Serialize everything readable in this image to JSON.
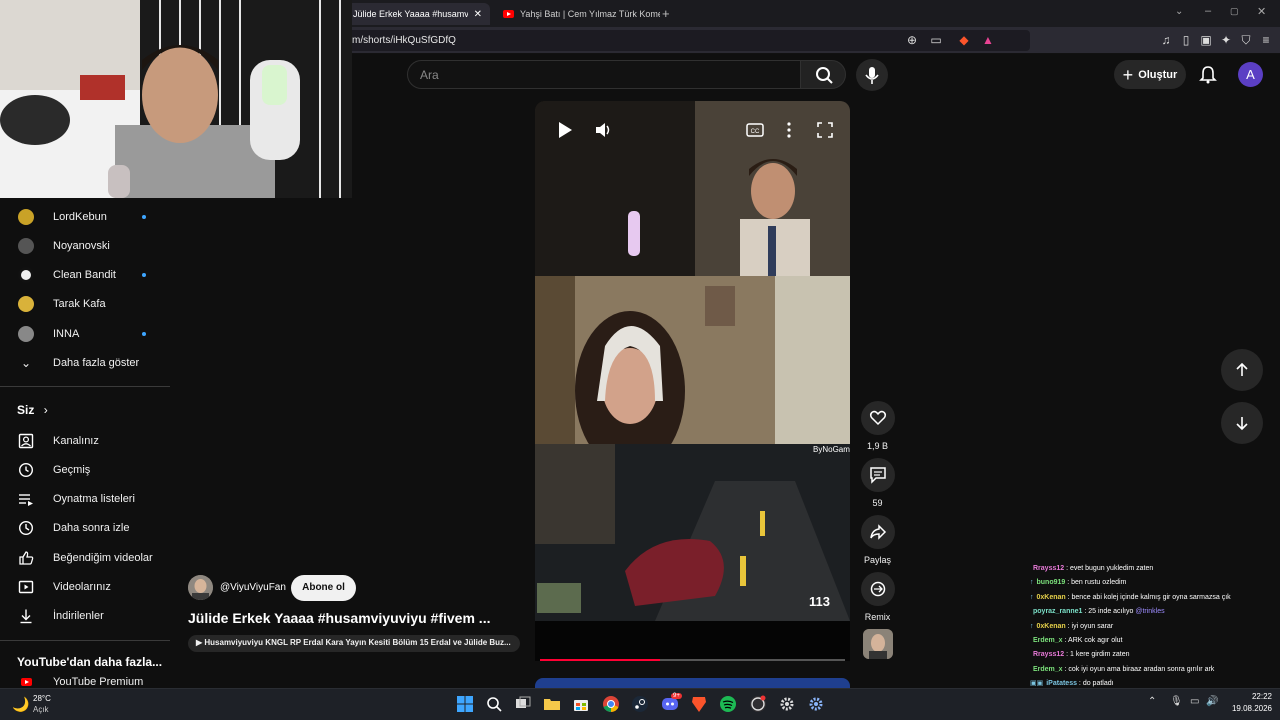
{
  "browser": {
    "tabs": [
      {
        "title": "Jülide Erkek Yaaaa #husamviyuviyu",
        "active": true
      },
      {
        "title": "Yahşi Batı | Cem Yılmaz Türk Komedi",
        "active": false
      }
    ],
    "new_tab": "+",
    "url": "m/shorts/iHkQuSfGDfQ"
  },
  "header": {
    "search_placeholder": "Ara",
    "create_label": "Oluştur",
    "avatar_letter": "A"
  },
  "sidebar": {
    "channels": [
      {
        "name": "LordKebun",
        "live": true,
        "color": "#c9a227"
      },
      {
        "name": "Noyanovski",
        "live": false,
        "color": "#555"
      },
      {
        "name": "Clean Bandit",
        "live": true,
        "color": "#eee"
      },
      {
        "name": "Tarak Kafa",
        "live": false,
        "color": "#d9b23a"
      },
      {
        "name": "INNA",
        "live": true,
        "color": "#888"
      }
    ],
    "show_more": "Daha fazla göster",
    "you_section": "Siz",
    "you_items": [
      {
        "label": "Kanalınız",
        "icon": "channel-icon"
      },
      {
        "label": "Geçmiş",
        "icon": "history-icon"
      },
      {
        "label": "Oynatma listeleri",
        "icon": "playlist-icon"
      },
      {
        "label": "Daha sonra izle",
        "icon": "watch-later-icon"
      },
      {
        "label": "Beğendiğim videolar",
        "icon": "liked-icon"
      },
      {
        "label": "Videolarınız",
        "icon": "your-videos-icon"
      },
      {
        "label": "İndirilenler",
        "icon": "downloads-icon"
      }
    ],
    "more_from": "YouTube'dan daha fazla...",
    "premium": "YouTube Premium"
  },
  "video": {
    "stream_tag": "ByNoGam",
    "speed": "113"
  },
  "actions": {
    "likes": "1,9 B",
    "comments": "59",
    "share": "Paylaş",
    "remix": "Remix"
  },
  "short": {
    "channel": "@ViyuViyuFan",
    "subscribe": "Abone ol",
    "title": "Jülide Erkek Yaaaa #husamviyuviyu #fivem ...",
    "playlist": "Husamviyuviyu KNGL RP Erdal Kara Yayın Kesiti Bölüm 15 Erdal ve Jülide Buz..."
  },
  "chat": [
    {
      "user": "Rrayss12",
      "color": "#e87ad8",
      "msg": " : evet bugun yukledim zaten",
      "badge": ""
    },
    {
      "user": "buno919",
      "color": "#7be07b",
      "msg": " : ben rustu ozledim",
      "badge": "↑"
    },
    {
      "user": "0xKenan",
      "color": "#e6d14a",
      "msg": " : bence abi kolej içinde kalmış gir oyna sarmazsa çık",
      "badge": "↑"
    },
    {
      "user": "poyraz_ranne1",
      "color": "#7be0c8",
      "msg": " : 25 inde acılıyo ",
      "mention": "@trinkles",
      "badge": ""
    },
    {
      "user": "0xKenan",
      "color": "#e6d14a",
      "msg": " : iyi oyun sarar",
      "badge": "↑"
    },
    {
      "user": "Erdem_x",
      "color": "#7be07b",
      "msg": " : ARK cok agır olut",
      "badge": ""
    },
    {
      "user": "Rrayss12",
      "color": "#e87ad8",
      "msg": " : 1 kere girdim zaten",
      "badge": ""
    },
    {
      "user": "Erdem_x",
      "color": "#7be07b",
      "msg": " : cok iyi oyun ama biraaz aradan sonra gırılır ark",
      "badge": ""
    },
    {
      "user": "iPatatess",
      "color": "#7bc4e0",
      "msg": " : do patladı",
      "badge": "▣▣"
    },
    {
      "user": "iPatatess",
      "color": "#7bc4e0",
      "msg": " : ",
      "badge": "▣▣"
    },
    {
      "user": "iPatatess",
      "color": "#7bc4e0",
      "msg": " : ben",
      "badge": "▣▣"
    }
  ],
  "taskbar": {
    "weather_temp": "28°C",
    "weather_desc": "Açık",
    "time": "22:22",
    "date": "19.08.2026",
    "notification_badge": "9+"
  }
}
